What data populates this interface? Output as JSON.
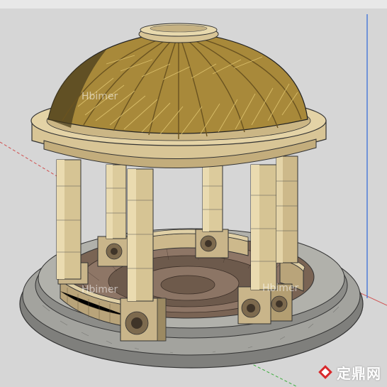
{
  "viewport": {
    "background": "#d6d6d6",
    "axis_colors": {
      "red": "#d05050",
      "green": "#3fae3f",
      "blue": "#3a6fd8"
    }
  },
  "model": {
    "subject": "gazebo",
    "dome_color": "#a8893a",
    "stone_color": "#d8c596",
    "floor_colors": [
      "#8a7060",
      "#6d5a4c",
      "#b8a48a"
    ],
    "step_color": "#8c8c88"
  },
  "watermark": {
    "text": "定鼎网",
    "ghost_text": "Hbimer"
  }
}
